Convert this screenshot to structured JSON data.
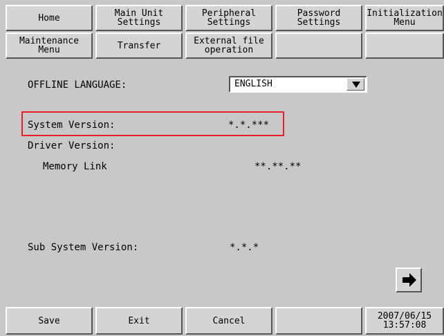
{
  "tabs_row1": [
    {
      "label": "Home"
    },
    {
      "label": "Main Unit\nSettings"
    },
    {
      "label": "Peripheral\nSettings"
    },
    {
      "label": "Password\nSettings"
    },
    {
      "label": "Initialization\nMenu"
    }
  ],
  "tabs_row2": [
    {
      "label": "Maintenance\nMenu"
    },
    {
      "label": "Transfer"
    },
    {
      "label": "External file\noperation"
    },
    {
      "label": ""
    },
    {
      "label": ""
    }
  ],
  "main": {
    "offline_language_label": "OFFLINE LANGUAGE:",
    "offline_language_value": "ENGLISH",
    "system_version_label": "System Version:",
    "system_version_value": "*.*.***",
    "driver_version_label": "Driver Version:",
    "memory_link_label": "Memory Link",
    "memory_link_value": "**.**.**",
    "sub_system_version_label": "Sub System Version:",
    "sub_system_version_value": "*.*.*"
  },
  "bottom": {
    "save_label": "Save",
    "exit_label": "Exit",
    "cancel_label": "Cancel",
    "empty_label": "",
    "date": "2007/06/15",
    "time": "13:57:08"
  },
  "icons": {
    "next": "arrow-right-icon",
    "dropdown": "triangle-down-icon"
  },
  "colors": {
    "background": "#c8c8c8",
    "highlight": "#e8202a"
  }
}
